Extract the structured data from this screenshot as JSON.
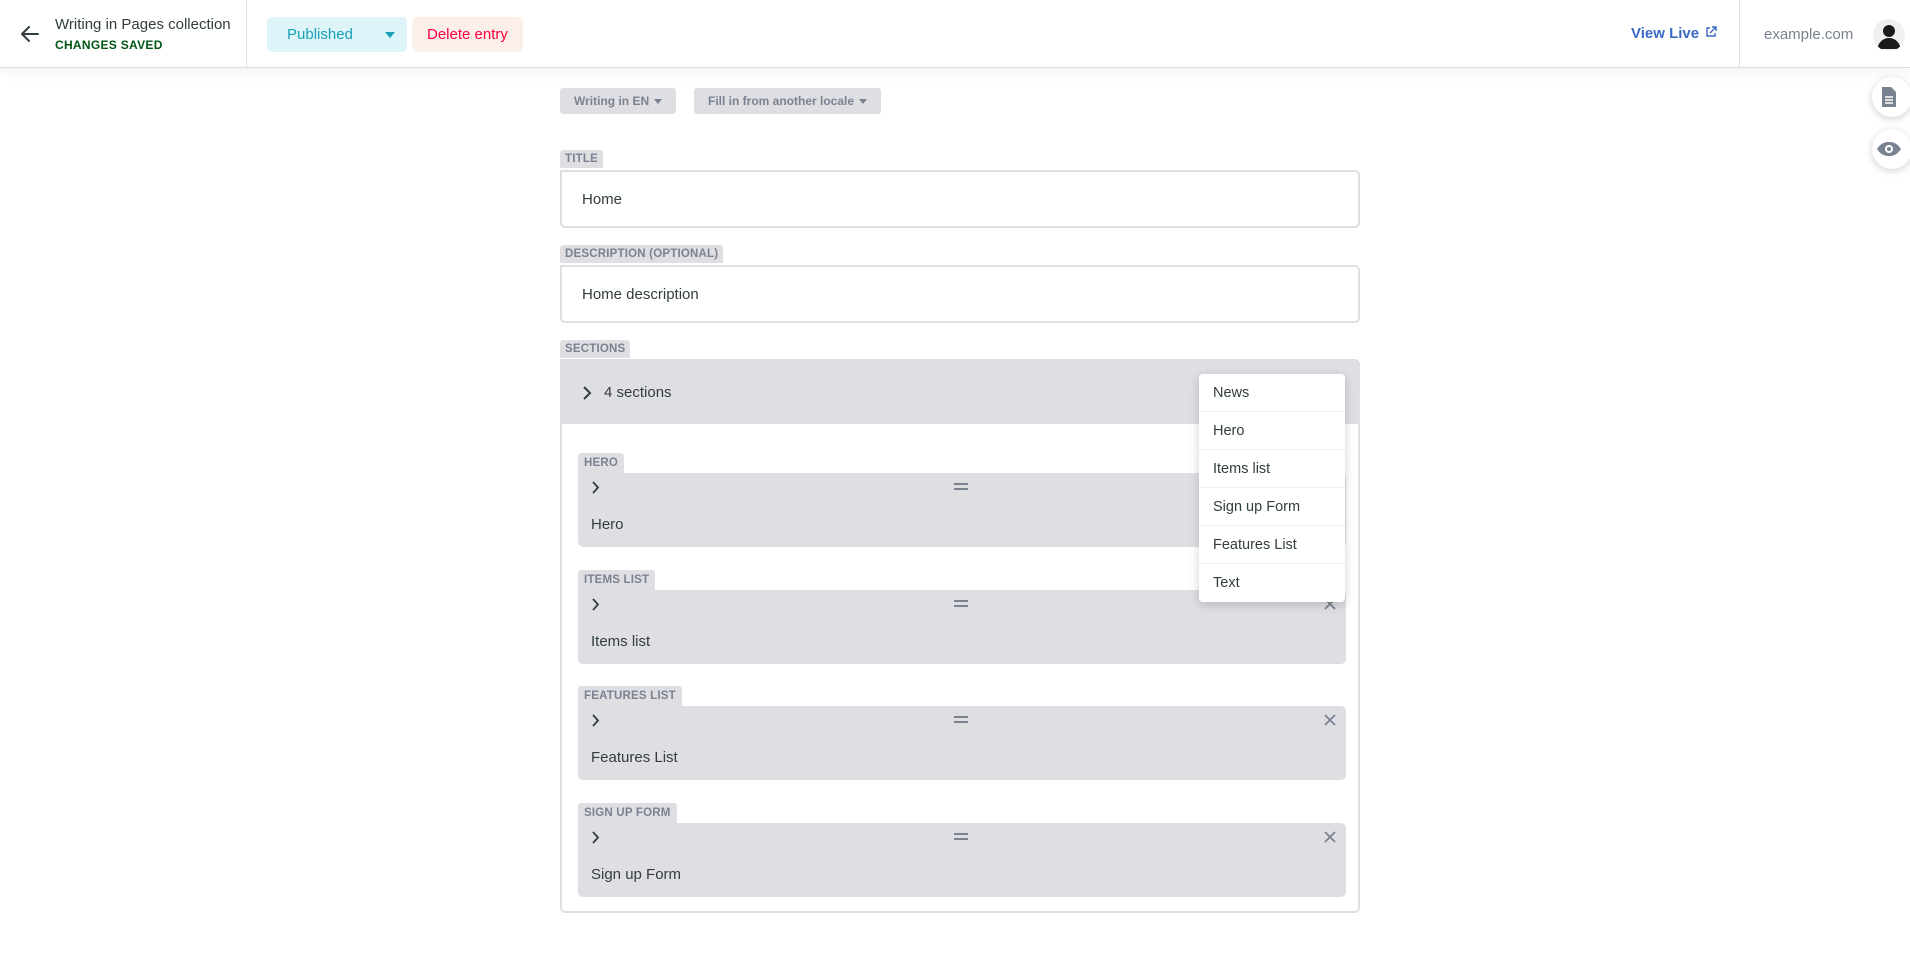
{
  "header": {
    "entry_title": "Writing in Pages collection",
    "entry_status": "CHANGES SAVED",
    "publish_label": "Published",
    "delete_label": "Delete entry",
    "view_live_label": "View Live",
    "site_name": "example.com"
  },
  "locale": {
    "writing_in": "Writing in EN",
    "fill_in": "Fill in from another locale"
  },
  "fields": {
    "title": {
      "label": "TITLE",
      "value": "Home"
    },
    "description": {
      "label": "DESCRIPTION (OPTIONAL)",
      "value": "Home description"
    }
  },
  "sections": {
    "label": "SECTIONS",
    "summary": "4 sections",
    "items": [
      {
        "type_label": "HERO",
        "title": "Hero"
      },
      {
        "type_label": "ITEMS LIST",
        "title": "Items list"
      },
      {
        "type_label": "FEATURES LIST",
        "title": "Features List"
      },
      {
        "type_label": "SIGN UP FORM",
        "title": "Sign up Form"
      }
    ]
  },
  "add_menu": {
    "options": [
      "News",
      "Hero",
      "Items list",
      "Sign up Form",
      "Features List",
      "Text"
    ]
  },
  "colors": {
    "publish_bg": "#ddf5f9",
    "publish_text": "#17a2b8",
    "delete_bg": "#fcefea",
    "delete_text": "#ff003b",
    "status_green": "#005614",
    "link_blue": "#3a69c7",
    "field_grey": "#dfdfe3"
  }
}
